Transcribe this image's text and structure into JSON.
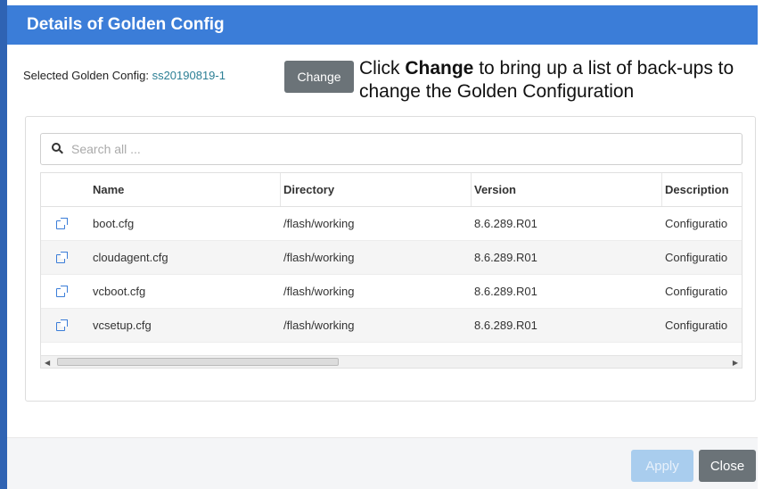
{
  "dialog": {
    "title": "Details of Golden Config"
  },
  "selected": {
    "label": "Selected Golden Config:",
    "value": "ss20190819-1",
    "change_label": "Change"
  },
  "annotation": {
    "prefix": "Click ",
    "bold": "Change",
    "suffix": " to bring up a list of back-ups to change the Golden Configuration"
  },
  "search": {
    "placeholder": "Search all ..."
  },
  "table": {
    "headers": [
      "",
      "Name",
      "Directory",
      "Version",
      "Description"
    ],
    "rows": [
      {
        "name": "boot.cfg",
        "directory": "/flash/working",
        "version": "8.6.289.R01",
        "description": "Configuratio"
      },
      {
        "name": "cloudagent.cfg",
        "directory": "/flash/working",
        "version": "8.6.289.R01",
        "description": "Configuratio"
      },
      {
        "name": "vcboot.cfg",
        "directory": "/flash/working",
        "version": "8.6.289.R01",
        "description": "Configuratio"
      },
      {
        "name": "vcsetup.cfg",
        "directory": "/flash/working",
        "version": "8.6.289.R01",
        "description": "Configuratio"
      }
    ]
  },
  "footer": {
    "apply_label": "Apply",
    "close_label": "Close"
  },
  "icons": {
    "search": "search-icon",
    "row_action": "external-link-icon"
  },
  "colors": {
    "header": "#3b7dd8",
    "selected_value": "#2c7f95",
    "button_gray": "#6b7378",
    "apply_disabled": "#a9cdee"
  }
}
